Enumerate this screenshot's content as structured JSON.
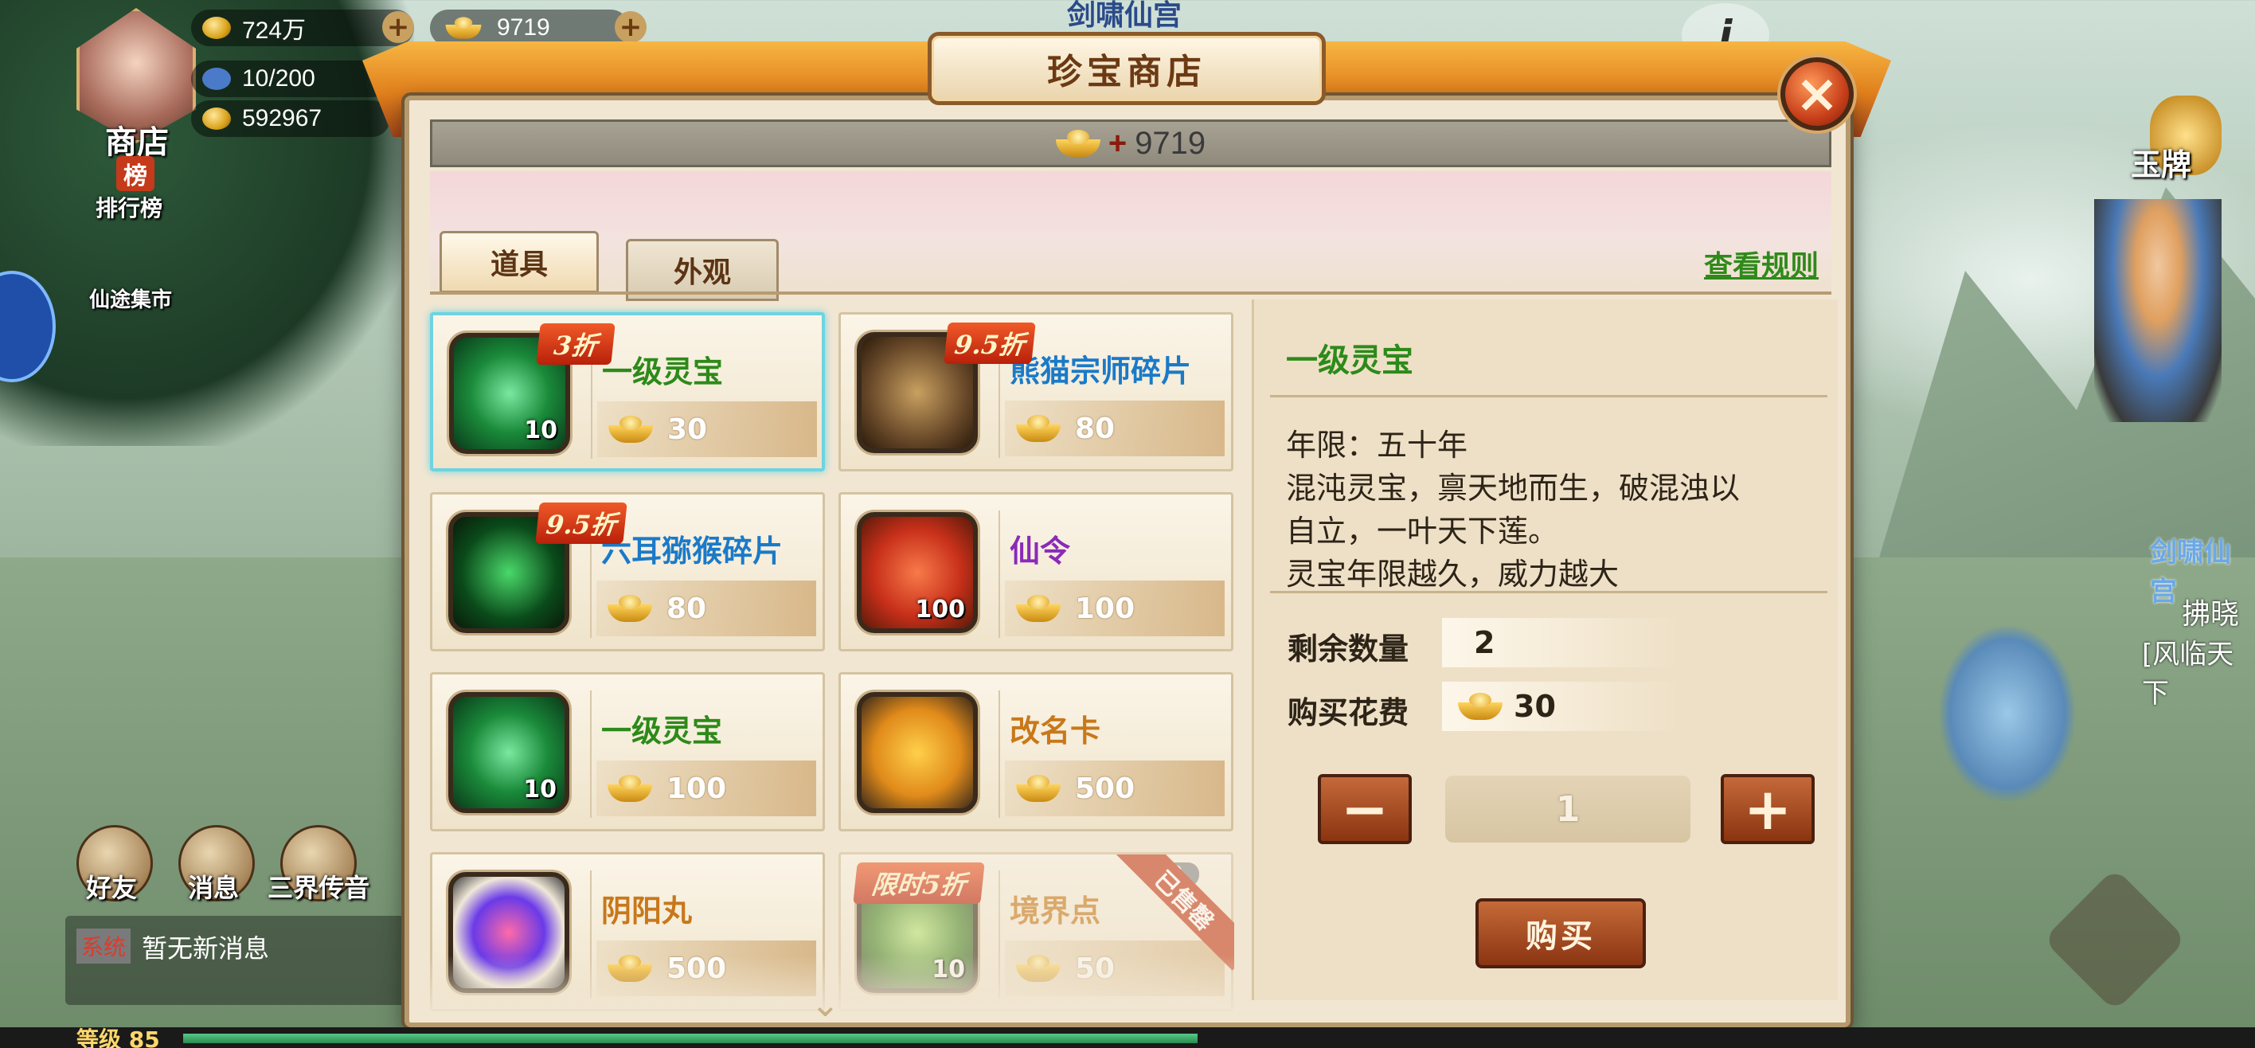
{
  "hud": {
    "silver": "724万",
    "gold": "9719",
    "stamina": "10/200",
    "power": "592967",
    "shop_label": "商店",
    "rank_badge": "榜",
    "rank_label": "排行榜",
    "market_label": "仙途集市",
    "friends": "好友",
    "messages": "消息",
    "broadcast": "三界传音",
    "system_tag": "系统",
    "no_messages": "暂无新消息",
    "level": "等级 85",
    "level_progress": 0.49,
    "right_badge": "玉牌",
    "right_name1": "剑啸仙宫",
    "right_name2": "拂晓",
    "right_name3": "[风临天下",
    "top_name": "剑啸仙宫",
    "info_icon": "i"
  },
  "shop": {
    "title": "珍宝商店",
    "gold_prefix": "+",
    "gold_amount": "9719",
    "tabs": [
      "道具",
      "外观"
    ],
    "rules_link": "查看规则",
    "items": [
      {
        "name": "一级灵宝",
        "price": "30",
        "qty": "10",
        "discount": "3折",
        "name_color": "#2d8a1a",
        "icon": "jade-lotus-icon",
        "selected": true
      },
      {
        "name": "熊猫宗师碎片",
        "price": "80",
        "qty": "",
        "discount": "9.5折",
        "name_color": "#1a7ac8",
        "icon": "panda-master-icon"
      },
      {
        "name": "六耳猕猴碎片",
        "price": "80",
        "qty": "",
        "discount": "9.5折",
        "name_color": "#1a7ac8",
        "icon": "macaque-mask-icon"
      },
      {
        "name": "仙令",
        "price": "100",
        "qty": "100",
        "discount": "",
        "name_color": "#8a2ab8",
        "icon": "immortal-token-icon"
      },
      {
        "name": "一级灵宝",
        "price": "100",
        "qty": "10",
        "discount": "",
        "name_color": "#2d8a1a",
        "icon": "jade-lotus-icon"
      },
      {
        "name": "改名卡",
        "price": "500",
        "qty": "",
        "discount": "",
        "name_color": "#c8781a",
        "icon": "rename-card-icon"
      },
      {
        "name": "阴阳丸",
        "price": "500",
        "qty": "",
        "discount": "",
        "name_color": "#c8781a",
        "icon": "yinyang-pill-icon"
      },
      {
        "name": "境界点",
        "price": "50",
        "qty": "10",
        "discount": "限时5折",
        "name_color": "#c8781a",
        "icon": "realm-point-icon",
        "sold_out": "已售罄",
        "stock_hint": "2"
      }
    ],
    "detail": {
      "title": "一级灵宝",
      "lines": [
        "年限：五十年",
        "混沌灵宝，禀天地而生，破混浊以",
        "自立，一叶天下莲。",
        "灵宝年限越久，威力越大"
      ],
      "remaining_label": "剩余数量",
      "remaining_value": "2",
      "cost_label": "购买花费",
      "cost_value": "30",
      "minus": "−",
      "plus": "+",
      "quantity": "1",
      "buy_label": "购买"
    }
  }
}
